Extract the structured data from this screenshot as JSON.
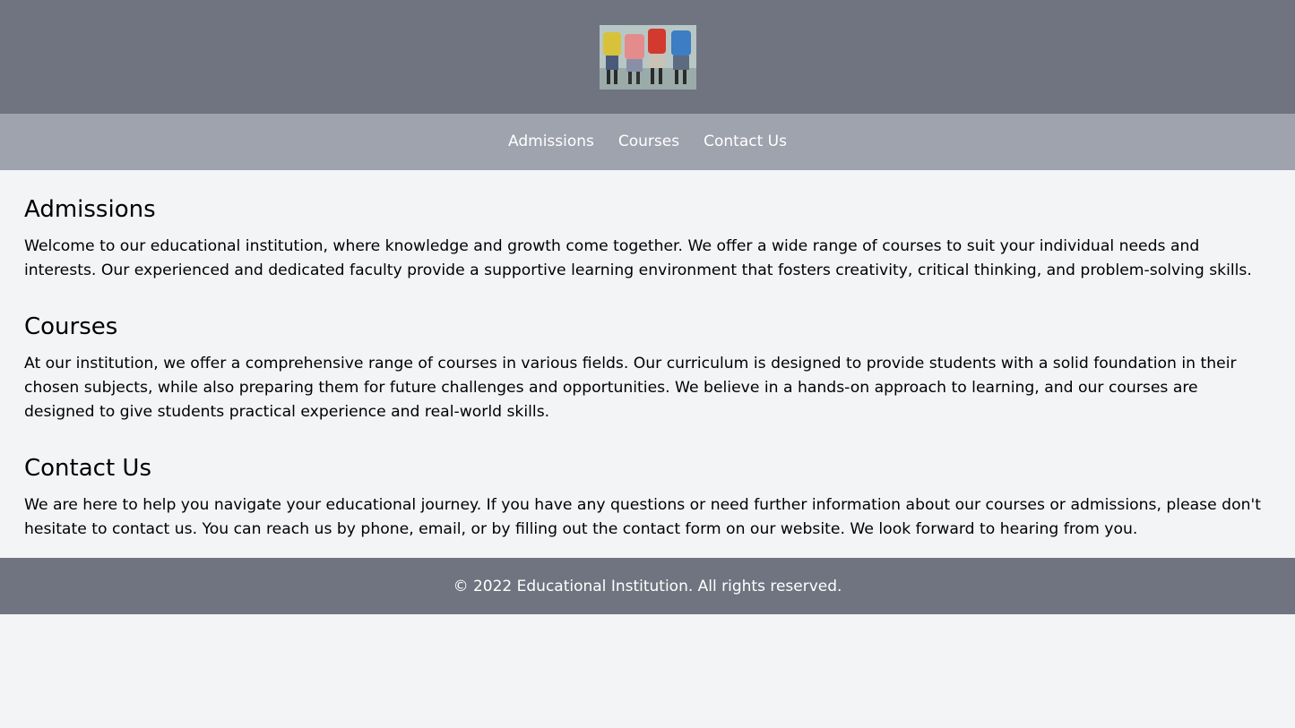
{
  "header": {
    "logo_icon": "school-children-backpacks-photo"
  },
  "nav": {
    "items": [
      {
        "label": "Admissions"
      },
      {
        "label": "Courses"
      },
      {
        "label": "Contact Us"
      }
    ]
  },
  "sections": [
    {
      "title": "Admissions",
      "body": "Welcome to our educational institution, where knowledge and growth come together. We offer a wide range of courses to suit your individual needs and interests. Our experienced and dedicated faculty provide a supportive learning environment that fosters creativity, critical thinking, and problem-solving skills."
    },
    {
      "title": "Courses",
      "body": "At our institution, we offer a comprehensive range of courses in various fields. Our curriculum is designed to provide students with a solid foundation in their chosen subjects, while also preparing them for future challenges and opportunities. We believe in a hands-on approach to learning, and our courses are designed to give students practical experience and real-world skills."
    },
    {
      "title": "Contact Us",
      "body": "We are here to help you navigate your educational journey. If you have any questions or need further information about our courses or admissions, please don't hesitate to contact us. You can reach us by phone, email, or by filling out the contact form on our website. We look forward to hearing from you."
    }
  ],
  "footer": {
    "text": "© 2022 Educational Institution. All rights reserved."
  },
  "colors": {
    "header_bg": "#6f7480",
    "nav_bg": "#9fa3ad",
    "page_bg": "#f3f4f6",
    "footer_bg": "#6f7480"
  }
}
